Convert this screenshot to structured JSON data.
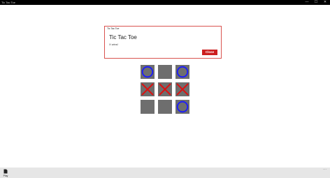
{
  "window": {
    "title": "Tic Tac Toe",
    "minimize_glyph": "—",
    "maximize_glyph": "☐",
    "close_glyph": "✕"
  },
  "dialog": {
    "header": "Tic Tac Toe",
    "title": "Tic Tac Toe",
    "message": "X wins!",
    "close_label": "Close"
  },
  "board": {
    "cells": [
      "O",
      "",
      "O",
      "X",
      "X",
      "X",
      "",
      "",
      "O"
    ],
    "colors": {
      "cell": "#6e6e6e",
      "o": "#1a1aff",
      "x": "#dd1111"
    }
  },
  "appbar": {
    "play_label": "Play",
    "play_icon": "document-icon",
    "more_glyph": "···"
  }
}
